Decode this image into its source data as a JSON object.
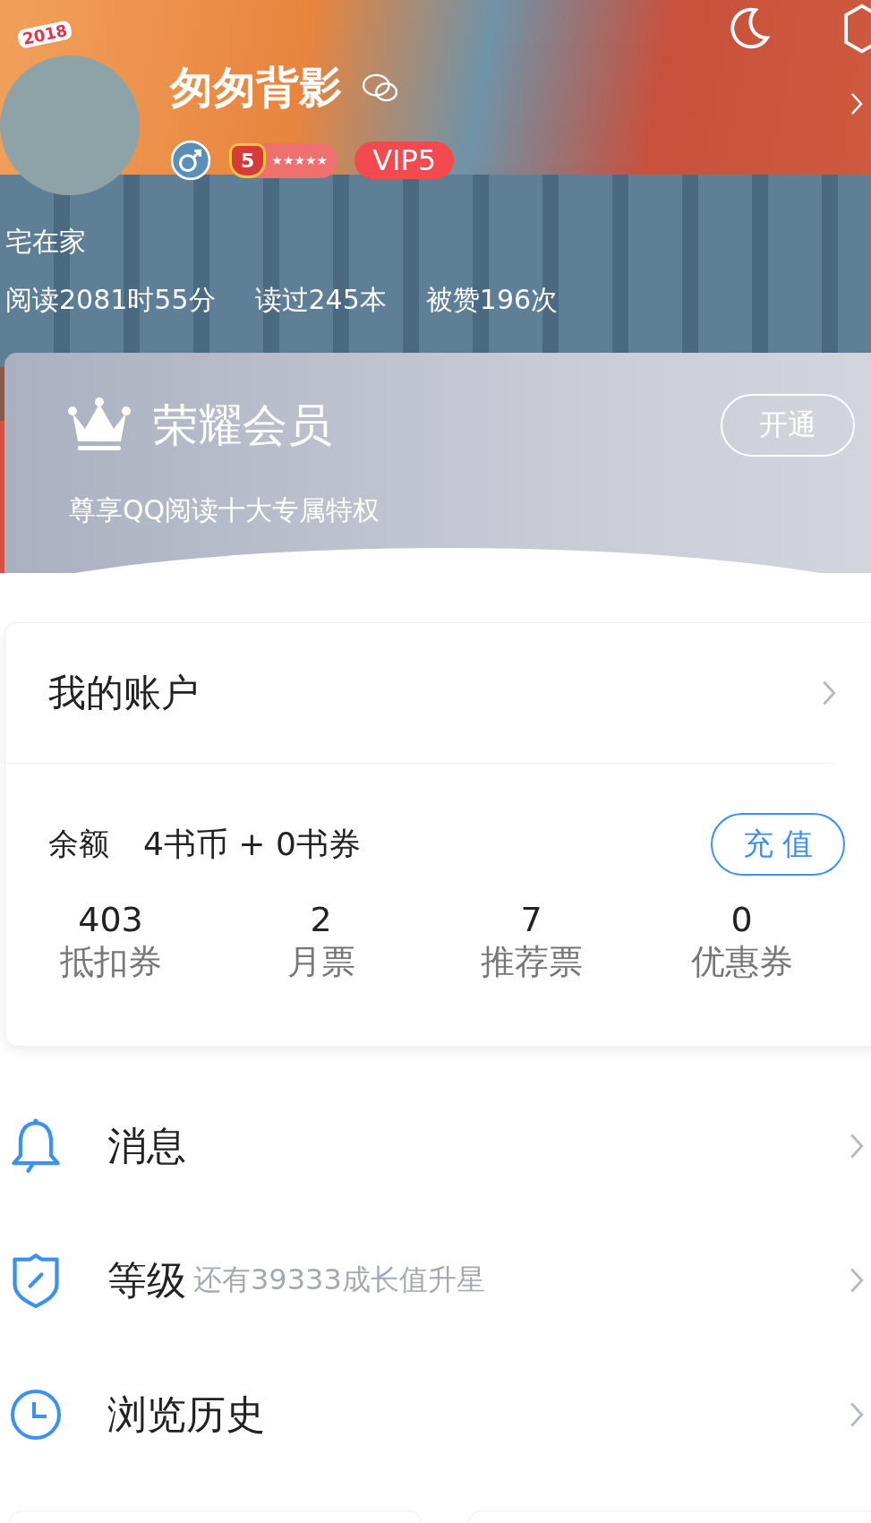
{
  "profile": {
    "year_badge": "2018",
    "name": "匆匆背影",
    "male": true,
    "level_badge": {
      "number": "5",
      "stars": 5
    },
    "vip": "VIP5",
    "signature": "宅在家",
    "stats": [
      "阅读2081时55分",
      "读过245本",
      "被赞196次"
    ]
  },
  "vip_card": {
    "title": "荣耀会员",
    "button": "开通",
    "subtitle": "尊享QQ阅读十大专属特权"
  },
  "account": {
    "title": "我的账户",
    "balance_label": "余额",
    "balance_value": "4书币 + 0书券",
    "recharge_button": "充 值",
    "items": [
      {
        "value": "403",
        "label": "抵扣券"
      },
      {
        "value": "2",
        "label": "月票"
      },
      {
        "value": "7",
        "label": "推荐票"
      },
      {
        "value": "0",
        "label": "优惠券"
      }
    ]
  },
  "menu": [
    {
      "kind": "bell",
      "label": "消息"
    },
    {
      "kind": "shield",
      "label": "等级",
      "hint": "还有39333成长值升星"
    },
    {
      "kind": "clock",
      "label": "浏览历史"
    }
  ]
}
